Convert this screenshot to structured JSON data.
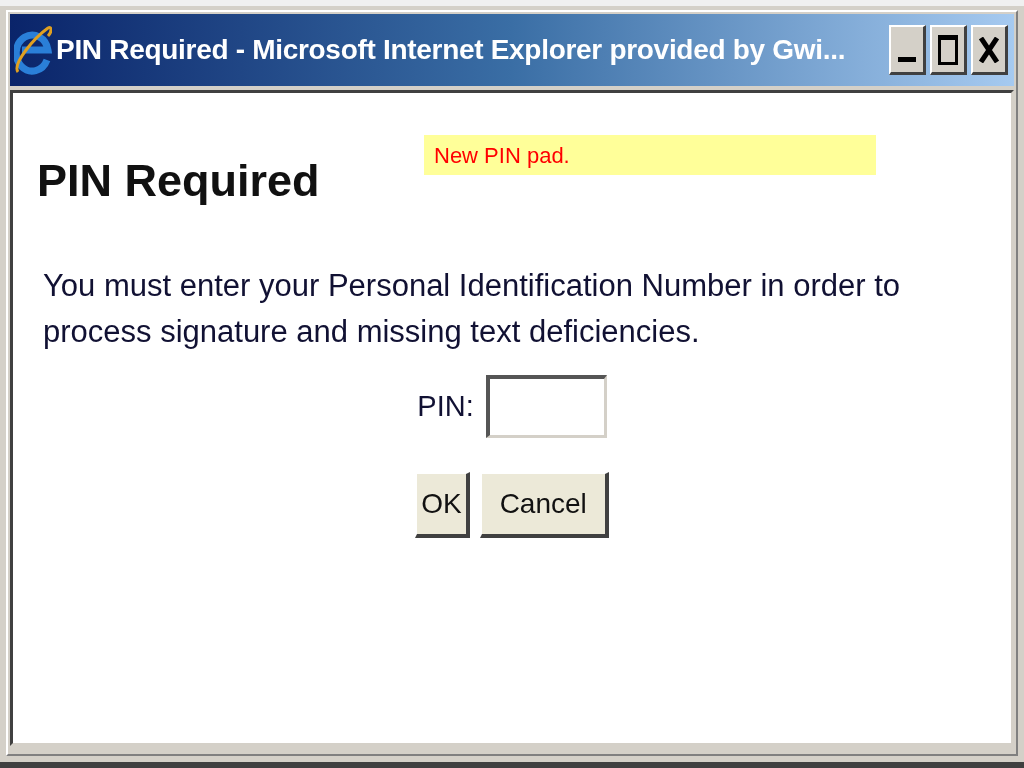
{
  "window": {
    "title": "PIN Required - Microsoft Internet Explorer provided by Gwi..."
  },
  "page": {
    "heading": "PIN Required",
    "note": "New PIN pad.",
    "message": "You must enter your Personal Identification Number in order to process signature and missing text deficiencies.",
    "pin_field": {
      "label": "PIN:"
    },
    "buttons": [
      {
        "label": "OK"
      },
      {
        "label": "Cancel"
      }
    ]
  }
}
